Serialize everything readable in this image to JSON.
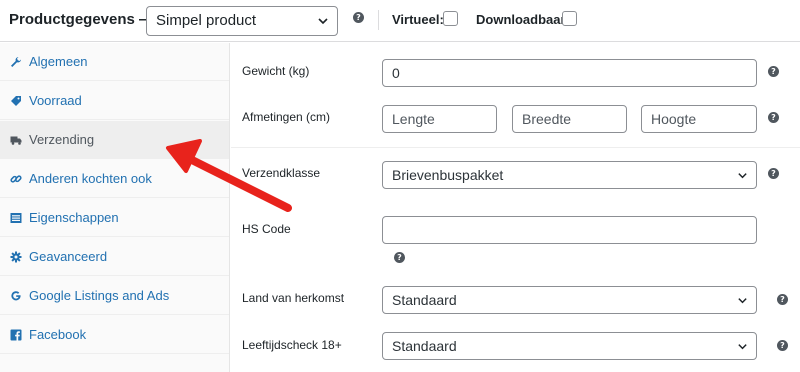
{
  "header": {
    "title": "Productgegevens —",
    "product_type": "Simpel product",
    "virtual_label": "Virtueel:",
    "downloadable_label": "Downloadbaar:"
  },
  "sidebar": {
    "items": [
      {
        "label": "Algemeen",
        "icon": "wrench-icon"
      },
      {
        "label": "Voorraad",
        "icon": "tag-icon"
      },
      {
        "label": "Verzending",
        "icon": "truck-icon"
      },
      {
        "label": "Anderen kochten ook",
        "icon": "link-icon"
      },
      {
        "label": "Eigenschappen",
        "icon": "list-icon"
      },
      {
        "label": "Geavanceerd",
        "icon": "gear-icon"
      },
      {
        "label": "Google Listings and Ads",
        "icon": "google-icon"
      },
      {
        "label": "Facebook",
        "icon": "facebook-icon"
      }
    ],
    "active_index": 2
  },
  "form": {
    "weight_label": "Gewicht (kg)",
    "weight_value": "0",
    "dimensions_label": "Afmetingen (cm)",
    "length_placeholder": "Lengte",
    "width_placeholder": "Breedte",
    "height_placeholder": "Hoogte",
    "shipping_class_label": "Verzendklasse",
    "shipping_class_value": "Brievenbuspakket",
    "hs_code_label": "HS Code",
    "hs_code_value": "",
    "origin_label": "Land van herkomst",
    "origin_value": "Standaard",
    "age_check_label": "Leeftijdscheck 18+",
    "age_check_value": "Standaard"
  },
  "help_glyph": "?",
  "colors": {
    "link": "#2271b1",
    "annotation_arrow": "#e8231c",
    "active_bg": "#eeeeee"
  }
}
